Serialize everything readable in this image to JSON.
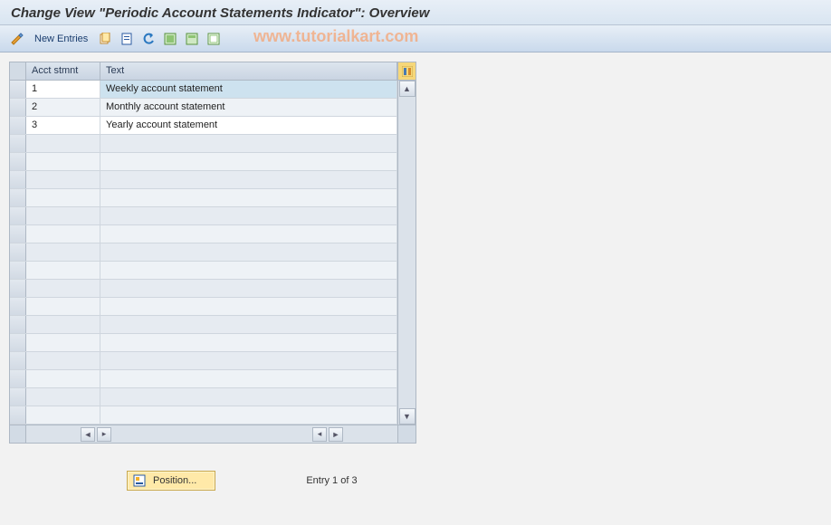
{
  "title": "Change View \"Periodic Account Statements Indicator\": Overview",
  "toolbar": {
    "new_entries": "New Entries"
  },
  "watermark": "www.tutorialkart.com",
  "grid": {
    "headers": {
      "c1": "Acct stmnt",
      "c2": "Text"
    },
    "rows": [
      {
        "id": "1",
        "text": "Weekly account statement"
      },
      {
        "id": "2",
        "text": "Monthly account statement"
      },
      {
        "id": "3",
        "text": "Yearly account statement"
      }
    ],
    "empty_rows": 16
  },
  "footer": {
    "position_label": "Position...",
    "status": "Entry 1 of 3"
  }
}
